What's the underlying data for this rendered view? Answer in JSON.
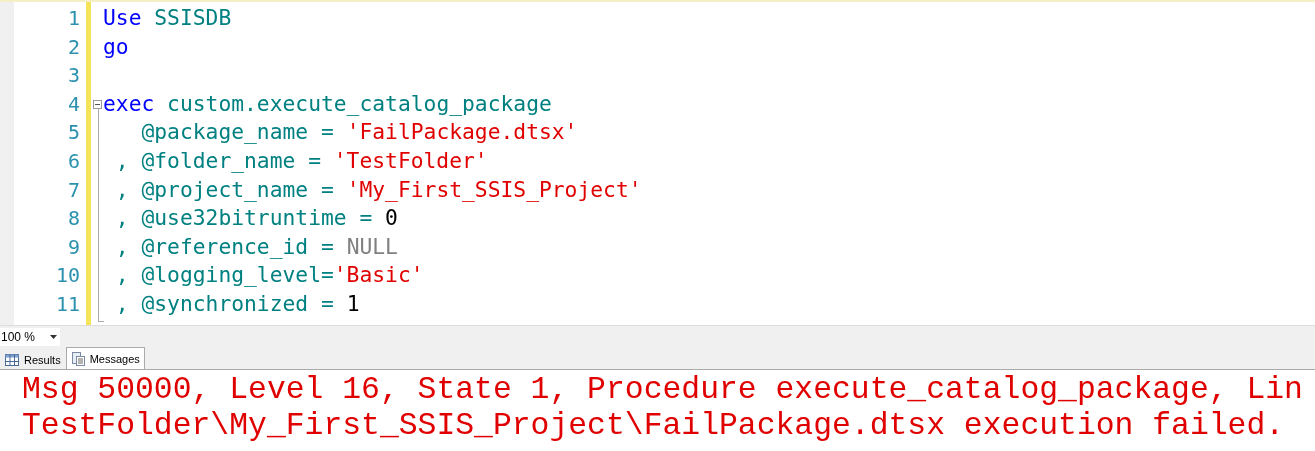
{
  "editor": {
    "lines": [
      {
        "number": "1",
        "collapsible": false,
        "tokens": [
          {
            "kind": "keyword",
            "text": "Use"
          },
          {
            "kind": "ident",
            "text": " SSISDB"
          }
        ]
      },
      {
        "number": "2",
        "collapsible": false,
        "tokens": [
          {
            "kind": "keyword",
            "text": "go"
          }
        ]
      },
      {
        "number": "3",
        "collapsible": false
      },
      {
        "number": "4",
        "collapsible": true,
        "tokens": [
          {
            "kind": "keyword",
            "text": "exec"
          },
          {
            "kind": "ident",
            "text": " custom.execute_catalog_package"
          }
        ]
      },
      {
        "number": "5",
        "collapsible": false,
        "tokens": [
          {
            "kind": "ident",
            "text": "   @package_name = "
          },
          {
            "kind": "string",
            "text": "'FailPackage.dtsx'"
          }
        ]
      },
      {
        "number": "6",
        "collapsible": false,
        "tokens": [
          {
            "kind": "ident",
            "text": " , @folder_name = "
          },
          {
            "kind": "string",
            "text": "'TestFolder'"
          }
        ]
      },
      {
        "number": "7",
        "collapsible": false,
        "tokens": [
          {
            "kind": "ident",
            "text": " , @project_name = "
          },
          {
            "kind": "string",
            "text": "'My_First_SSIS_Project'"
          }
        ]
      },
      {
        "number": "8",
        "collapsible": false,
        "tokens": [
          {
            "kind": "ident",
            "text": " , @use32bitruntime = "
          },
          {
            "kind": "number",
            "text": "0"
          }
        ]
      },
      {
        "number": "9",
        "collapsible": false,
        "tokens": [
          {
            "kind": "ident",
            "text": " , @reference_id = "
          },
          {
            "kind": "null",
            "text": "NULL"
          }
        ]
      },
      {
        "number": "10",
        "collapsible": false,
        "tokens": [
          {
            "kind": "ident",
            "text": " , @logging_level="
          },
          {
            "kind": "string",
            "text": "'Basic'"
          }
        ]
      },
      {
        "number": "11",
        "collapsible": false,
        "tokens": [
          {
            "kind": "ident",
            "text": " , @synchronized = "
          },
          {
            "kind": "number",
            "text": "1"
          }
        ]
      }
    ]
  },
  "zoom": {
    "value": "100 %"
  },
  "tabs": [
    {
      "label": "Results",
      "kind": "grid",
      "selected": false
    },
    {
      "label": "Messages",
      "kind": "messages",
      "selected": true
    }
  ],
  "messages": [
    "Msg 50000, Level 16, State 1, Procedure execute_catalog_package, Lin",
    "TestFolder\\My_First_SSIS_Project\\FailPackage.dtsx execution failed."
  ]
}
